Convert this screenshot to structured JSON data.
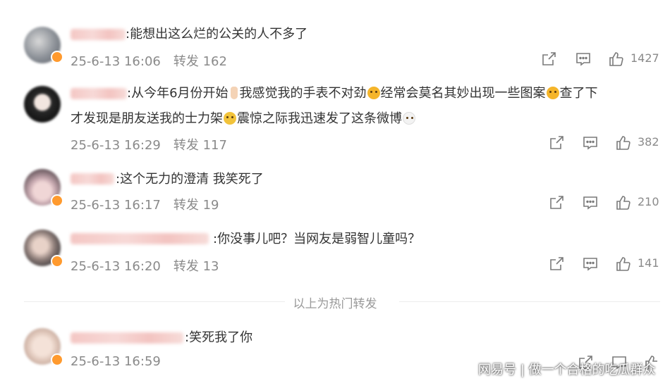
{
  "comments": [
    {
      "text": ":能想出这么烂的公关的人不多了",
      "time": "25-6-13 16:06",
      "repost": "转发 162",
      "likes": "1427"
    },
    {
      "text_line1_a": ":从今年6月份开始",
      "text_line1_b": "我感觉我的手表不对劲",
      "text_line1_c": "经常会莫名其妙出现一些图案",
      "text_line1_d": "查了下",
      "text_line2_a": "才发现是朋友送我的士力架",
      "text_line2_b": "震惊之际我迅速发了这条微博",
      "time": "25-6-13 16:29",
      "repost": "转发 117",
      "likes": "382"
    },
    {
      "text": ":这个无力的澄清 我笑死了",
      "time": "25-6-13 16:17",
      "repost": "转发 19",
      "likes": "210"
    },
    {
      "text": ":你没事儿吧？当网友是弱智儿童吗？",
      "time": "25-6-13 16:20",
      "repost": "转发 13",
      "likes": "141"
    },
    {
      "text": ":笑死我了你",
      "time": "25-6-13 16:59"
    }
  ],
  "divider": "以上为热门转发",
  "watermark": "网易号 | 做一个合格的吃瓜群众",
  "colors": {
    "meta_gray": "#8a8a8a",
    "text": "#333333",
    "badge": "#ff9a2e",
    "name_blur": "#f4c7c4"
  },
  "icons": {
    "share": "share-out-icon",
    "comment": "comment-bubble-icon",
    "like": "thumbs-up-icon"
  }
}
